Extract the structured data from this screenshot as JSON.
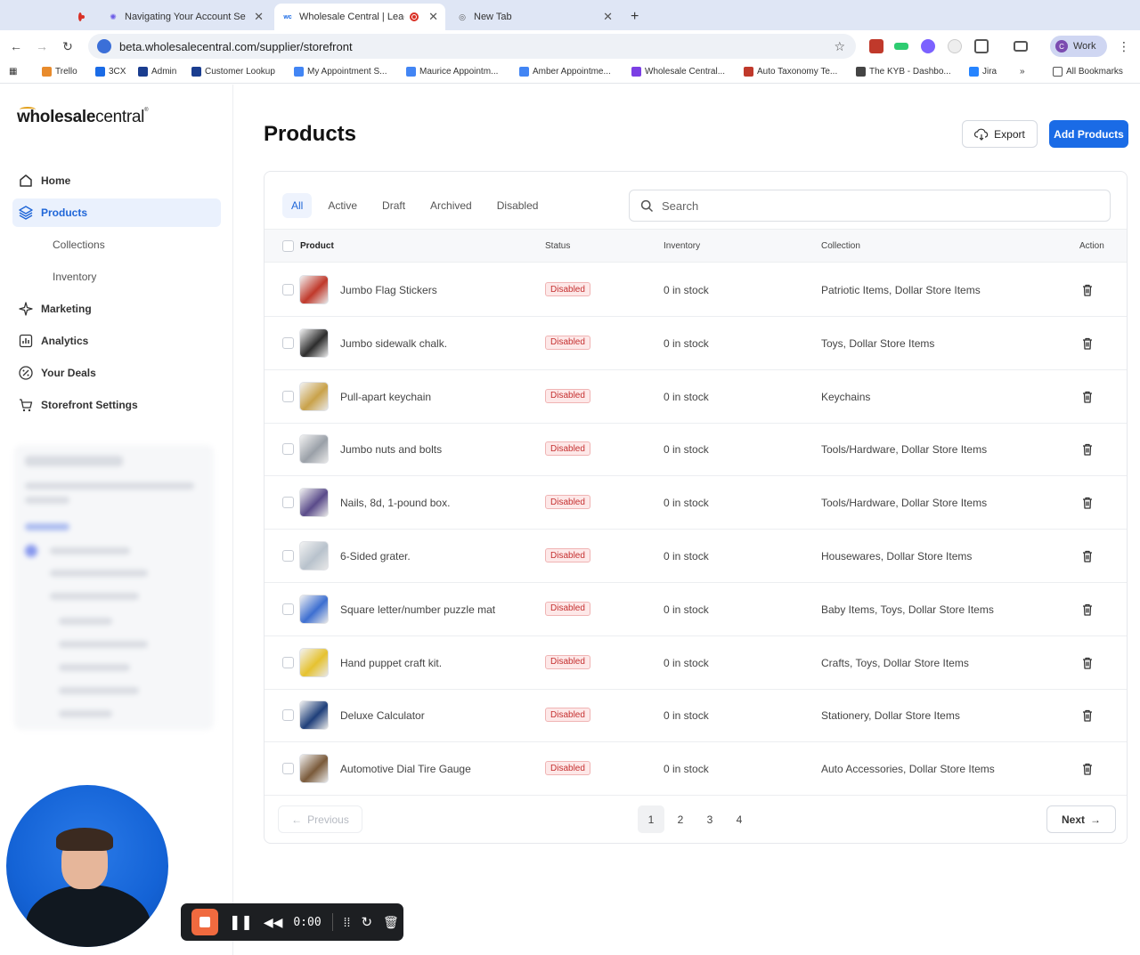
{
  "browser": {
    "tabs": [
      {
        "title": "Navigating Your Account Setti",
        "active": false
      },
      {
        "title": "Wholesale Central | Leadin",
        "active": true
      },
      {
        "title": "New Tab",
        "active": false
      }
    ],
    "url": "beta.wholesalecentral.com/supplier/storefront",
    "profile_label": "Work",
    "profile_initial": "C",
    "bookmarks": [
      "Trello",
      "3CX",
      "Admin",
      "Customer Lookup",
      "My Appointment S...",
      "Maurice Appointm...",
      "Amber Appointme...",
      "Wholesale Central...",
      "Auto Taxonomy Te...",
      "The KYB - Dashbo...",
      "Jira",
      "All Bookmarks"
    ],
    "bookmarks_more": "»"
  },
  "sidebar": {
    "logo_text_bold": "wholesale",
    "logo_text": "central",
    "logo_mark": "®",
    "items": [
      {
        "label": "Home"
      },
      {
        "label": "Products"
      },
      {
        "label": "Collections"
      },
      {
        "label": "Inventory"
      },
      {
        "label": "Marketing"
      },
      {
        "label": "Analytics"
      },
      {
        "label": "Your Deals"
      },
      {
        "label": "Storefront Settings"
      }
    ]
  },
  "header": {
    "title": "Products",
    "export_label": "Export",
    "add_label": "Add Products"
  },
  "filters": {
    "tabs": [
      "All",
      "Active",
      "Draft",
      "Archived",
      "Disabled"
    ],
    "search_placeholder": "Search"
  },
  "table": {
    "columns": [
      "Product",
      "Status",
      "Inventory",
      "Collection",
      "Action"
    ],
    "rows": [
      {
        "name": "Jumbo Flag Stickers",
        "status": "Disabled",
        "inventory": "0 in stock",
        "collection": "Patriotic Items, Dollar Store Items",
        "thumb_color": "#c0392b"
      },
      {
        "name": "Jumbo sidewalk chalk.",
        "status": "Disabled",
        "inventory": "0 in stock",
        "collection": "Toys, Dollar Store Items",
        "thumb_color": "#2d2d2d"
      },
      {
        "name": "Pull-apart keychain",
        "status": "Disabled",
        "inventory": "0 in stock",
        "collection": "Keychains",
        "thumb_color": "#c9a24a"
      },
      {
        "name": "Jumbo nuts and bolts",
        "status": "Disabled",
        "inventory": "0 in stock",
        "collection": "Tools/Hardware, Dollar Store Items",
        "thumb_color": "#9aa0a8"
      },
      {
        "name": "Nails, 8d, 1-pound box.",
        "status": "Disabled",
        "inventory": "0 in stock",
        "collection": "Tools/Hardware, Dollar Store Items",
        "thumb_color": "#5a4b8a"
      },
      {
        "name": "6-Sided grater.",
        "status": "Disabled",
        "inventory": "0 in stock",
        "collection": "Housewares, Dollar Store Items",
        "thumb_color": "#b8c2cc"
      },
      {
        "name": "Square letter/number puzzle mat",
        "status": "Disabled",
        "inventory": "0 in stock",
        "collection": "Baby Items, Toys, Dollar Store Items",
        "thumb_color": "#3d6fd1"
      },
      {
        "name": "Hand puppet craft kit.",
        "status": "Disabled",
        "inventory": "0 in stock",
        "collection": "Crafts, Toys, Dollar Store Items",
        "thumb_color": "#e6c230"
      },
      {
        "name": "Deluxe Calculator",
        "status": "Disabled",
        "inventory": "0 in stock",
        "collection": "Stationery, Dollar Store Items",
        "thumb_color": "#1f3f7a"
      },
      {
        "name": "Automotive Dial Tire Gauge",
        "status": "Disabled",
        "inventory": "0 in stock",
        "collection": "Auto Accessories, Dollar Store Items",
        "thumb_color": "#7a5a3a"
      }
    ]
  },
  "pagination": {
    "previous_label": "Previous",
    "next_label": "Next",
    "pages": [
      "1",
      "2",
      "3",
      "4"
    ],
    "current": "1"
  },
  "recorder": {
    "time": "0:00",
    "accent": "#f06a3f"
  },
  "colors": {
    "primary": "#1a6be6",
    "danger_badge": "#c53030"
  }
}
